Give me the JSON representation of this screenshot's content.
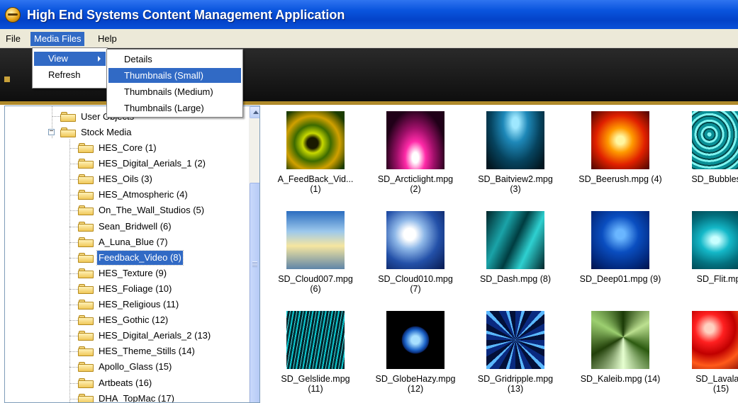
{
  "window": {
    "title": "High End Systems Content Management Application"
  },
  "menubar": {
    "file": "File",
    "media_files": "Media Files",
    "help": "Help"
  },
  "media_menu": {
    "view": "View",
    "refresh": "Refresh"
  },
  "view_submenu": [
    "Details",
    "Thumbnails (Small)",
    "Thumbnails (Medium)",
    "Thumbnails (Large)"
  ],
  "view_submenu_selected": "Thumbnails (Small)",
  "tree": {
    "user_objects": "User Objects",
    "stock_media": "Stock Media",
    "items": [
      "HES_Core (1)",
      "HES_Digital_Aerials_1 (2)",
      "HES_Oils (3)",
      "HES_Atmospheric (4)",
      "On_The_Wall_Studios (5)",
      "Sean_Bridwell (6)",
      "A_Luna_Blue (7)",
      "Feedback_Video (8)",
      "HES_Texture (9)",
      "HES_Foliage (10)",
      "HES_Religious (11)",
      "HES_Gothic (12)",
      "HES_Digital_Aerials_2 (13)",
      "HES_Theme_Stills (14)",
      "Apollo_Glass (15)",
      "Artbeats (16)",
      "DHA_TopMac (17)"
    ],
    "selected": "Feedback_Video (8)"
  },
  "thumbnails": [
    {
      "line1": "A_FeedBack_Vid...",
      "line2": "(1)"
    },
    {
      "line1": "SD_Arcticlight.mpg",
      "line2": "(2)"
    },
    {
      "line1": "SD_Baitview2.mpg",
      "line2": "(3)"
    },
    {
      "line1": "SD_Beerush.mpg (4)",
      "line2": ""
    },
    {
      "line1": "SD_Bubbles.m",
      "line2": ""
    },
    {
      "line1": "SD_Cloud007.mpg",
      "line2": "(6)"
    },
    {
      "line1": "SD_Cloud010.mpg",
      "line2": "(7)"
    },
    {
      "line1": "SD_Dash.mpg (8)",
      "line2": ""
    },
    {
      "line1": "SD_Deep01.mpg (9)",
      "line2": ""
    },
    {
      "line1": "SD_Flit.mpg",
      "line2": ""
    },
    {
      "line1": "SD_Gelslide.mpg",
      "line2": "(11)"
    },
    {
      "line1": "SD_GlobeHazy.mpg",
      "line2": "(12)"
    },
    {
      "line1": "SD_Gridripple.mpg",
      "line2": "(13)"
    },
    {
      "line1": "SD_Kaleib.mpg (14)",
      "line2": ""
    },
    {
      "line1": "SD_Lavalam",
      "line2": "(15)"
    }
  ],
  "colors": {
    "titlebar": "#0a55de",
    "selection": "#316ac5",
    "menubar": "#ece9d8",
    "toolbar": "#1a1a1a",
    "gold_strip": "#b08a2a"
  }
}
